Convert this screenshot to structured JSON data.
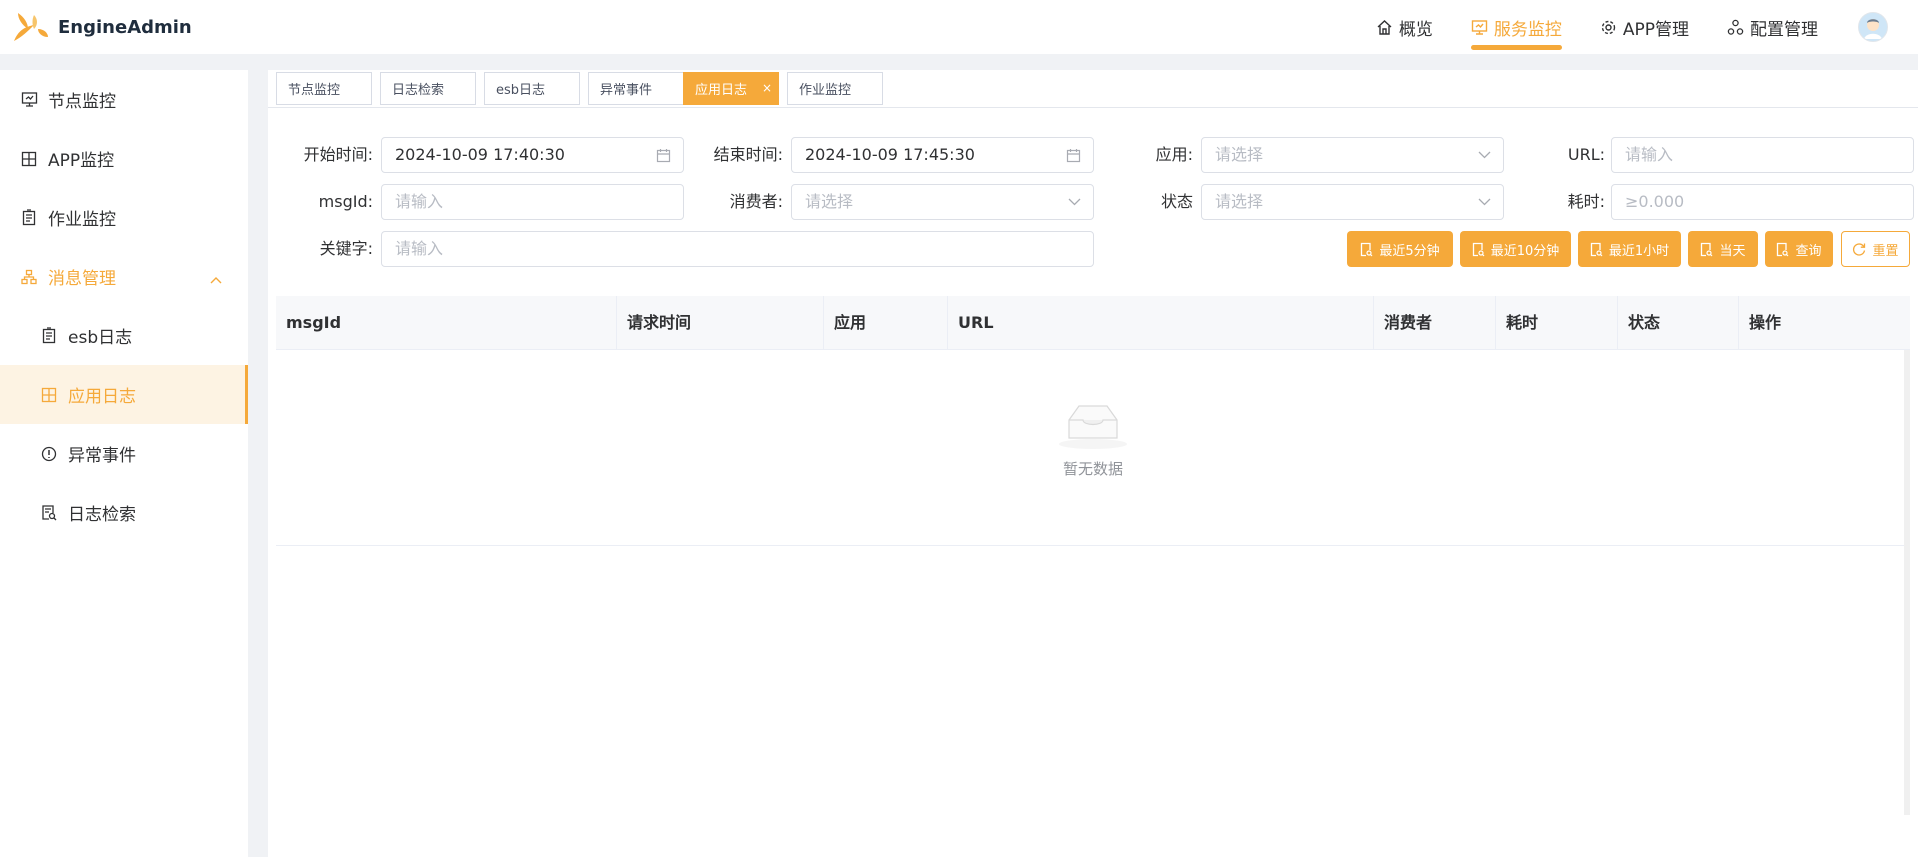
{
  "app": {
    "name": "EngineAdmin"
  },
  "topnav": [
    {
      "label": "概览",
      "icon": "home-icon",
      "active": false
    },
    {
      "label": "服务监控",
      "icon": "monitor-icon",
      "active": true
    },
    {
      "label": "APP管理",
      "icon": "gear-icon",
      "active": false
    },
    {
      "label": "配置管理",
      "icon": "cluster-icon",
      "active": false
    }
  ],
  "sidebar": {
    "items": [
      {
        "label": "节点监控",
        "icon": "monitor-icon"
      },
      {
        "label": "APP监控",
        "icon": "apps-icon"
      },
      {
        "label": "作业监控",
        "icon": "clipboard-icon"
      },
      {
        "label": "消息管理",
        "icon": "org-icon",
        "expanded": true
      },
      {
        "label": "esb日志",
        "icon": "clipboard-icon"
      },
      {
        "label": "应用日志",
        "icon": "apps-icon",
        "active": true
      },
      {
        "label": "异常事件",
        "icon": "alert-circle-icon"
      },
      {
        "label": "日志检索",
        "icon": "doc-search-icon"
      }
    ]
  },
  "tabs": [
    {
      "label": "节点监控"
    },
    {
      "label": "日志检索"
    },
    {
      "label": "esb日志"
    },
    {
      "label": "异常事件"
    },
    {
      "label": "应用日志",
      "active": true,
      "close": "×"
    },
    {
      "label": "作业监控"
    }
  ],
  "form": {
    "start_label": "开始时间:",
    "start_value": "2024-10-09 17:40:30",
    "end_label": "结束时间:",
    "end_value": "2024-10-09 17:45:30",
    "app_label": "应用:",
    "app_placeholder": "请选择",
    "url_label": "URL:",
    "url_placeholder": "请输入",
    "msgid_label": "msgId:",
    "msgid_placeholder": "请输入",
    "consumer_label": "消费者:",
    "consumer_placeholder": "请选择",
    "status_label": "状态",
    "status_placeholder": "请选择",
    "cost_label": "耗时:",
    "cost_placeholder": "≥0.000",
    "keyword_label": "关键字:",
    "keyword_placeholder": "请输入"
  },
  "buttons": {
    "last5": "最近5分钟",
    "last10": "最近10分钟",
    "last1h": "最近1小时",
    "today": "当天",
    "query": "查询",
    "reset": "重置"
  },
  "table": {
    "columns": [
      "msgId",
      "请求时间",
      "应用",
      "URL",
      "消费者",
      "耗时",
      "状态",
      "操作"
    ],
    "rows": [],
    "empty_text": "暂无数据"
  },
  "colors": {
    "accent": "#f5a93a",
    "accent_bg": "#fdf3e3"
  }
}
